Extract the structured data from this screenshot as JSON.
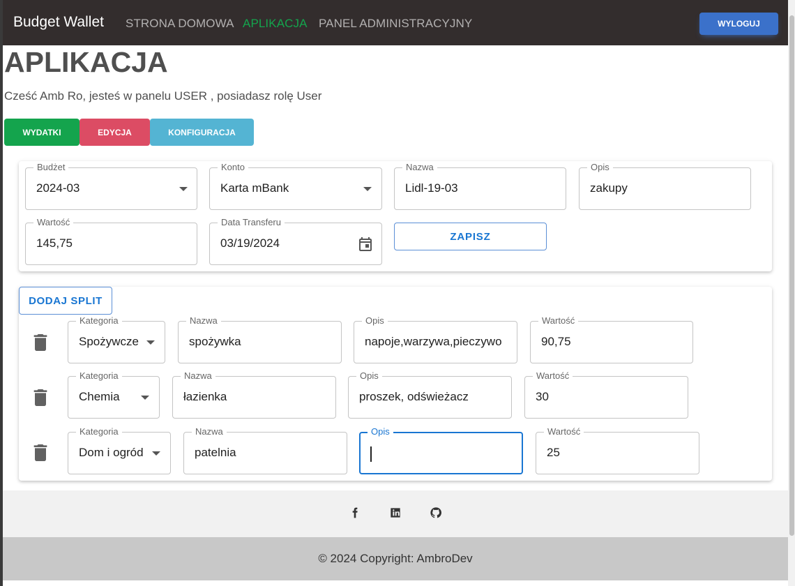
{
  "header": {
    "brand": "Budget Wallet",
    "nav": [
      "STRONA DOMOWA",
      "APLIKACJA",
      "PANEL ADMINISTRACYJNY"
    ],
    "active_nav": "APLIKACJA",
    "logout_label": "WYLOGUJ"
  },
  "page": {
    "title": "APLIKACJA",
    "greeting": "Cześć Amb Ro, jesteś w panelu USER , posiadasz rolę User"
  },
  "tabs": [
    {
      "label": "WYDATKI",
      "color": "#14a44d"
    },
    {
      "label": "EDYCJA",
      "color": "#dc4c64"
    },
    {
      "label": "KONFIGURACJA",
      "color": "#54b4d3"
    }
  ],
  "transaction": {
    "budget": {
      "label": "Budżet",
      "value": "2024-03"
    },
    "account": {
      "label": "Konto",
      "value": "Karta mBank"
    },
    "name": {
      "label": "Nazwa",
      "value": "Lidl-19-03"
    },
    "description": {
      "label": "Opis",
      "value": "zakupy"
    },
    "amount": {
      "label": "Wartość",
      "value": "145,75"
    },
    "date": {
      "label": "Data Transferu",
      "value": "03/19/2024"
    },
    "save_label": "ZAPISZ"
  },
  "splits": {
    "add_label": "DODAJ SPLIT",
    "labels": {
      "category": "Kategoria",
      "name": "Nazwa",
      "description": "Opis",
      "amount": "Wartość"
    },
    "rows": [
      {
        "category": "Spożywcze",
        "name": "spożywka",
        "description": "napoje,warzywa,pieczywo",
        "amount": "90,75"
      },
      {
        "category": "Chemia",
        "name": "łazienka",
        "description": "proszek, odświeżacz",
        "amount": "30"
      },
      {
        "category": "Dom i ogród",
        "name": "patelnia",
        "description": "",
        "amount": "25"
      }
    ]
  },
  "footer": {
    "social_icons": [
      "facebook-icon",
      "linkedin-icon",
      "github-icon"
    ],
    "copyright": "© 2024 Copyright: AmbroDev"
  },
  "colors": {
    "accent": "#1976d2",
    "topbar": "#332d2d",
    "active_nav": "#14a44d"
  }
}
